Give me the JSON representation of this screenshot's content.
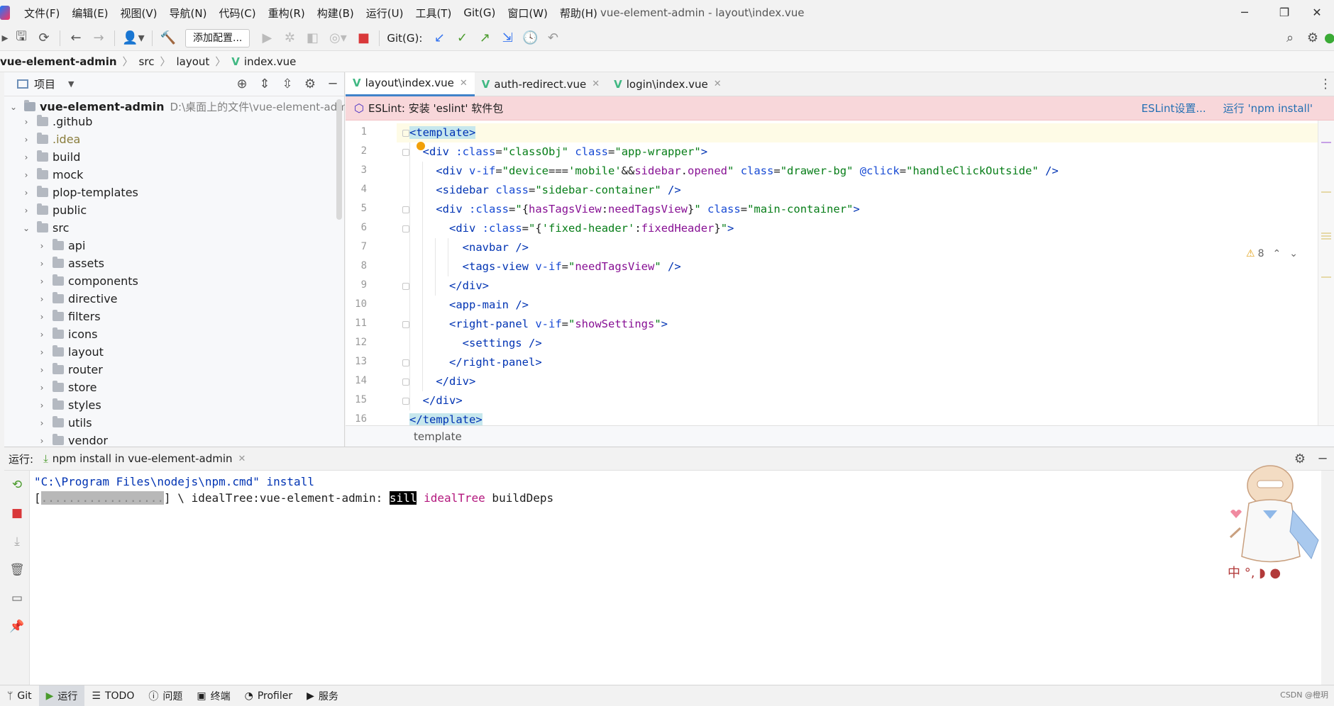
{
  "window": {
    "title": "vue-element-admin - layout\\index.vue",
    "menus": [
      "文件(F)",
      "编辑(E)",
      "视图(V)",
      "导航(N)",
      "代码(C)",
      "重构(R)",
      "构建(B)",
      "运行(U)",
      "工具(T)",
      "Git(G)",
      "窗口(W)",
      "帮助(H)"
    ]
  },
  "toolbar": {
    "add_config_label": "添加配置...",
    "git_label": "Git(G):"
  },
  "breadcrumb": [
    "vue-element-admin",
    "src",
    "layout",
    "index.vue"
  ],
  "project_panel": {
    "title": "项目",
    "root": {
      "name": "vue-element-admin",
      "path": "D:\\桌面上的文件\\vue-element-adm"
    },
    "top_items": [
      ".github",
      ".idea",
      "build",
      "mock",
      "plop-templates",
      "public",
      "src"
    ],
    "src_items": [
      "api",
      "assets",
      "components",
      "directive",
      "filters",
      "icons",
      "layout",
      "router",
      "store",
      "styles",
      "utils",
      "vendor"
    ]
  },
  "editor": {
    "tabs": [
      {
        "label": "layout\\index.vue",
        "active": true
      },
      {
        "label": "auth-redirect.vue",
        "active": false
      },
      {
        "label": "login\\index.vue",
        "active": false
      }
    ],
    "eslint_message": "ESLint: 安装 'eslint' 软件包",
    "eslint_settings_link": "ESLint设置...",
    "eslint_run_link": "运行 'npm install'",
    "warning_count": "8",
    "line_numbers": [
      "1",
      "2",
      "3",
      "4",
      "5",
      "6",
      "7",
      "8",
      "9",
      "10",
      "11",
      "12",
      "13",
      "14",
      "15",
      "16"
    ],
    "footer_breadcrumb": "template"
  },
  "run_panel": {
    "label": "运行:",
    "tab_label": "npm install in vue-element-admin",
    "console_line1_path": "\"C:\\Program Files\\nodejs\\npm.cmd\"",
    "console_line1_cmd": " install",
    "console_line2_progress": "..................",
    "console_line2_mid": "] \\ idealTree:vue-element-admin: ",
    "console_line2_sill": "sill",
    "console_line2_ideal": "idealTree",
    "console_line2_tail": " buildDeps"
  },
  "statusbar": {
    "items": [
      "Git",
      "运行",
      "TODO",
      "问题",
      "终端",
      "Profiler",
      "服务"
    ],
    "watermark": "CSDN @橙玥"
  },
  "colors": {
    "accent": "#4083c9",
    "eslint_bar": "#f8d7da",
    "vue_green": "#41b883",
    "tag_blue": "#0033b3",
    "string_green": "#067d17"
  }
}
